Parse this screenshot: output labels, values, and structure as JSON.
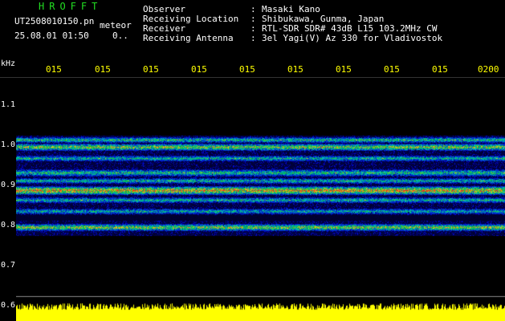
{
  "header": {
    "brand": "HROFFT",
    "filename": "UT2508010150.pn",
    "mode": "meteor",
    "datetime": "25.08.01 01:50",
    "page_indicator": "0..",
    "fields": [
      {
        "label": "Observer",
        "value": "Masaki Kano"
      },
      {
        "label": "Receiving Location",
        "value": "Shibukawa, Gunma, Japan"
      },
      {
        "label": "Receiver",
        "value": "RTL-SDR SDR# 43dB L15 103.2MHz CW"
      },
      {
        "label": "Receiving Antenna",
        "value": "3el Yagi(V) Az 330 for Vladivostok"
      }
    ]
  },
  "axes": {
    "y_unit": "kHz",
    "y_ticks": [
      "1.1",
      "1.0",
      "0.9",
      "0.8",
      "0.7",
      "0.6"
    ],
    "x_ticks": [
      "015",
      "015",
      "015",
      "015",
      "015",
      "015",
      "015",
      "015",
      "015",
      "0200"
    ]
  },
  "colors": {
    "background": "#000000",
    "label_text": "#ffffff",
    "brand_green": "#22dd22",
    "tick_yellow": "#ffff00",
    "spectrum_base": "#00007a"
  }
}
